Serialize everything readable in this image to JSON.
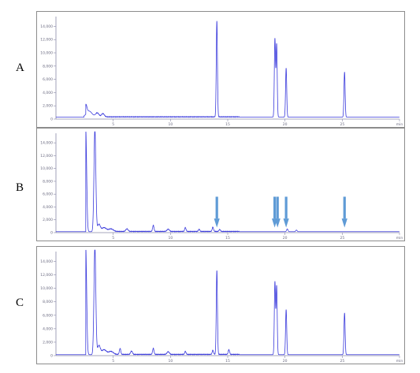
{
  "panels": [
    {
      "label": "A"
    },
    {
      "label": "B"
    },
    {
      "label": "C"
    }
  ],
  "colors": {
    "trace": "#3a3adc",
    "axis": "#8a8aa8",
    "tick_text": "#6a6a80",
    "arrow": "#5f9bd6",
    "frame": "#8c8c8c"
  },
  "chart_data": [
    {
      "type": "line",
      "panel": "A",
      "xlim": [
        0,
        30
      ],
      "ylim": [
        0,
        15000
      ],
      "yticks": [
        0,
        2000,
        4000,
        6000,
        8000,
        10000,
        12000,
        14000
      ],
      "xticks": [
        5,
        10,
        15,
        20,
        25,
        30
      ],
      "xtick_labels": [
        "5",
        "10",
        "15",
        "20",
        "25",
        "min"
      ],
      "grid": false,
      "baseline": 300,
      "peaks": [
        {
          "x": 2.6,
          "y": 1500,
          "w": 0.1
        },
        {
          "x": 2.9,
          "y": 900,
          "w": 0.25
        },
        {
          "x": 3.6,
          "y": 600,
          "w": 0.15
        },
        {
          "x": 4.1,
          "y": 500,
          "w": 0.12
        },
        {
          "x": 14.05,
          "y": 14500,
          "w": 0.05
        },
        {
          "x": 19.12,
          "y": 11800,
          "w": 0.05
        },
        {
          "x": 19.27,
          "y": 11000,
          "w": 0.05
        },
        {
          "x": 20.1,
          "y": 7400,
          "w": 0.05
        },
        {
          "x": 25.2,
          "y": 6800,
          "w": 0.05
        }
      ],
      "arrows": []
    },
    {
      "type": "line",
      "panel": "B",
      "xlim": [
        0,
        30
      ],
      "ylim": [
        0,
        15000
      ],
      "yticks": [
        0,
        2000,
        4000,
        6000,
        8000,
        10000,
        12000,
        14000
      ],
      "xticks": [
        5,
        10,
        15,
        20,
        25,
        30
      ],
      "xtick_labels": [
        "5",
        "10",
        "15",
        "20",
        "25",
        "min"
      ],
      "grid": false,
      "baseline": 150,
      "peaks": [
        {
          "x": 2.6,
          "y": 16000,
          "w": 0.08
        },
        {
          "x": 3.4,
          "y": 16000,
          "w": 0.08
        },
        {
          "x": 3.75,
          "y": 1100,
          "w": 0.12
        },
        {
          "x": 4.2,
          "y": 600,
          "w": 0.2
        },
        {
          "x": 4.8,
          "y": 400,
          "w": 0.2
        },
        {
          "x": 6.2,
          "y": 400,
          "w": 0.1
        },
        {
          "x": 8.5,
          "y": 950,
          "w": 0.06
        },
        {
          "x": 9.8,
          "y": 350,
          "w": 0.1
        },
        {
          "x": 11.3,
          "y": 600,
          "w": 0.06
        },
        {
          "x": 12.5,
          "y": 350,
          "w": 0.06
        },
        {
          "x": 13.7,
          "y": 650,
          "w": 0.06
        },
        {
          "x": 14.3,
          "y": 300,
          "w": 0.06
        },
        {
          "x": 20.2,
          "y": 420,
          "w": 0.06
        },
        {
          "x": 21.0,
          "y": 250,
          "w": 0.06
        }
      ],
      "arrows": [
        14.05,
        19.1,
        19.35,
        20.1,
        25.2
      ]
    },
    {
      "type": "line",
      "panel": "C",
      "xlim": [
        0,
        30
      ],
      "ylim": [
        0,
        15000
      ],
      "yticks": [
        0,
        2000,
        4000,
        6000,
        8000,
        10000,
        12000,
        14000
      ],
      "xticks": [
        5,
        10,
        15,
        20,
        25,
        30
      ],
      "xtick_labels": [
        "5",
        "10",
        "15",
        "20",
        "25",
        "min"
      ],
      "grid": false,
      "baseline": 150,
      "peaks": [
        {
          "x": 2.6,
          "y": 16000,
          "w": 0.08
        },
        {
          "x": 3.4,
          "y": 16000,
          "w": 0.08
        },
        {
          "x": 3.75,
          "y": 1300,
          "w": 0.12
        },
        {
          "x": 4.2,
          "y": 700,
          "w": 0.2
        },
        {
          "x": 4.8,
          "y": 450,
          "w": 0.2
        },
        {
          "x": 5.6,
          "y": 900,
          "w": 0.06
        },
        {
          "x": 6.6,
          "y": 500,
          "w": 0.08
        },
        {
          "x": 8.5,
          "y": 900,
          "w": 0.06
        },
        {
          "x": 9.8,
          "y": 400,
          "w": 0.1
        },
        {
          "x": 11.3,
          "y": 450,
          "w": 0.06
        },
        {
          "x": 13.7,
          "y": 600,
          "w": 0.06
        },
        {
          "x": 14.05,
          "y": 12500,
          "w": 0.05
        },
        {
          "x": 15.1,
          "y": 700,
          "w": 0.06
        },
        {
          "x": 19.12,
          "y": 10800,
          "w": 0.05
        },
        {
          "x": 19.27,
          "y": 10200,
          "w": 0.05
        },
        {
          "x": 20.1,
          "y": 6700,
          "w": 0.05
        },
        {
          "x": 25.2,
          "y": 6200,
          "w": 0.05
        }
      ],
      "arrows": []
    }
  ]
}
